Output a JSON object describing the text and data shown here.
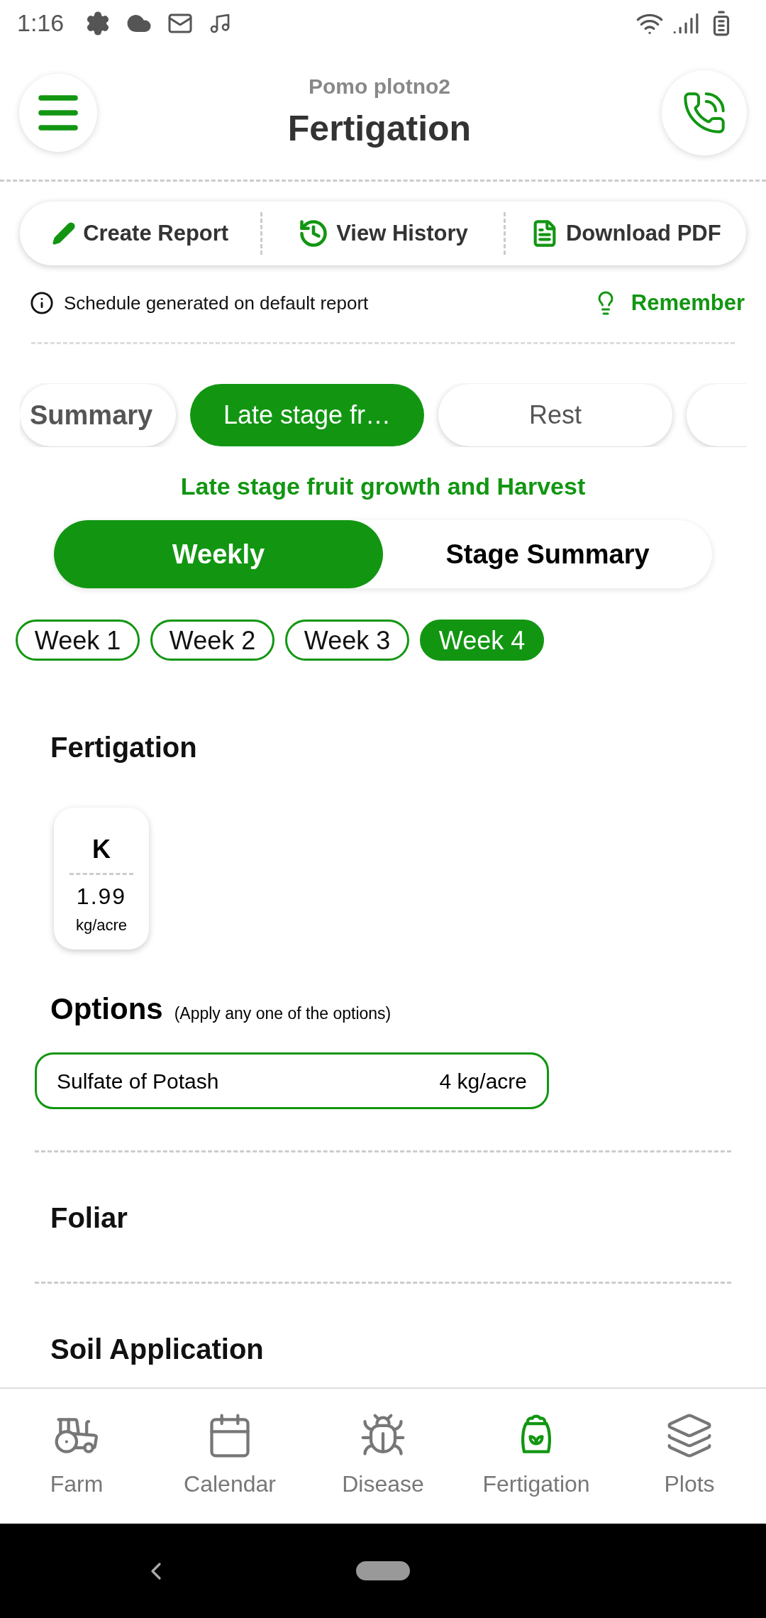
{
  "status_bar": {
    "time": "1:16"
  },
  "header": {
    "subtitle": "Pomo plotno2",
    "title": "Fertigation"
  },
  "actions": [
    {
      "label": "Create Report",
      "kind": "edit"
    },
    {
      "label": "View History",
      "kind": "history"
    },
    {
      "label": "Download PDF",
      "kind": "pdf"
    }
  ],
  "info": {
    "text": "Schedule generated on default report",
    "remember": "Remember"
  },
  "stage_tabs": [
    {
      "label": "Summary",
      "selected": false,
      "kind": "summary"
    },
    {
      "label": "Late stage fr…",
      "selected": true,
      "kind": "stage"
    },
    {
      "label": "Rest",
      "selected": false,
      "kind": "stage"
    }
  ],
  "stage_title": "Late stage fruit growth and Harvest",
  "view_toggle": [
    {
      "label": "Weekly",
      "selected": true
    },
    {
      "label": "Stage Summary",
      "selected": false
    }
  ],
  "weeks": [
    {
      "label": "Week 1",
      "selected": false
    },
    {
      "label": "Week 2",
      "selected": false
    },
    {
      "label": "Week 3",
      "selected": false
    },
    {
      "label": "Week 4",
      "selected": true
    }
  ],
  "fertigation": {
    "heading": "Fertigation",
    "nutrients": [
      {
        "symbol": "K",
        "amount": "1.99",
        "unit": "kg/acre"
      }
    ],
    "options_heading": "Options",
    "options_note": "(Apply any one of the options)",
    "options": [
      {
        "name": "Sulfate of Potash",
        "amount": "4 kg/acre"
      }
    ]
  },
  "sections": [
    "Foliar",
    "Soil Application"
  ],
  "bottom_nav": [
    {
      "label": "Farm",
      "kind": "farm",
      "selected": false
    },
    {
      "label": "Calendar",
      "kind": "calendar",
      "selected": false
    },
    {
      "label": "Disease",
      "kind": "disease",
      "selected": false
    },
    {
      "label": "Fertigation",
      "kind": "fertigation",
      "selected": true
    },
    {
      "label": "Plots",
      "kind": "plots",
      "selected": false
    }
  ]
}
